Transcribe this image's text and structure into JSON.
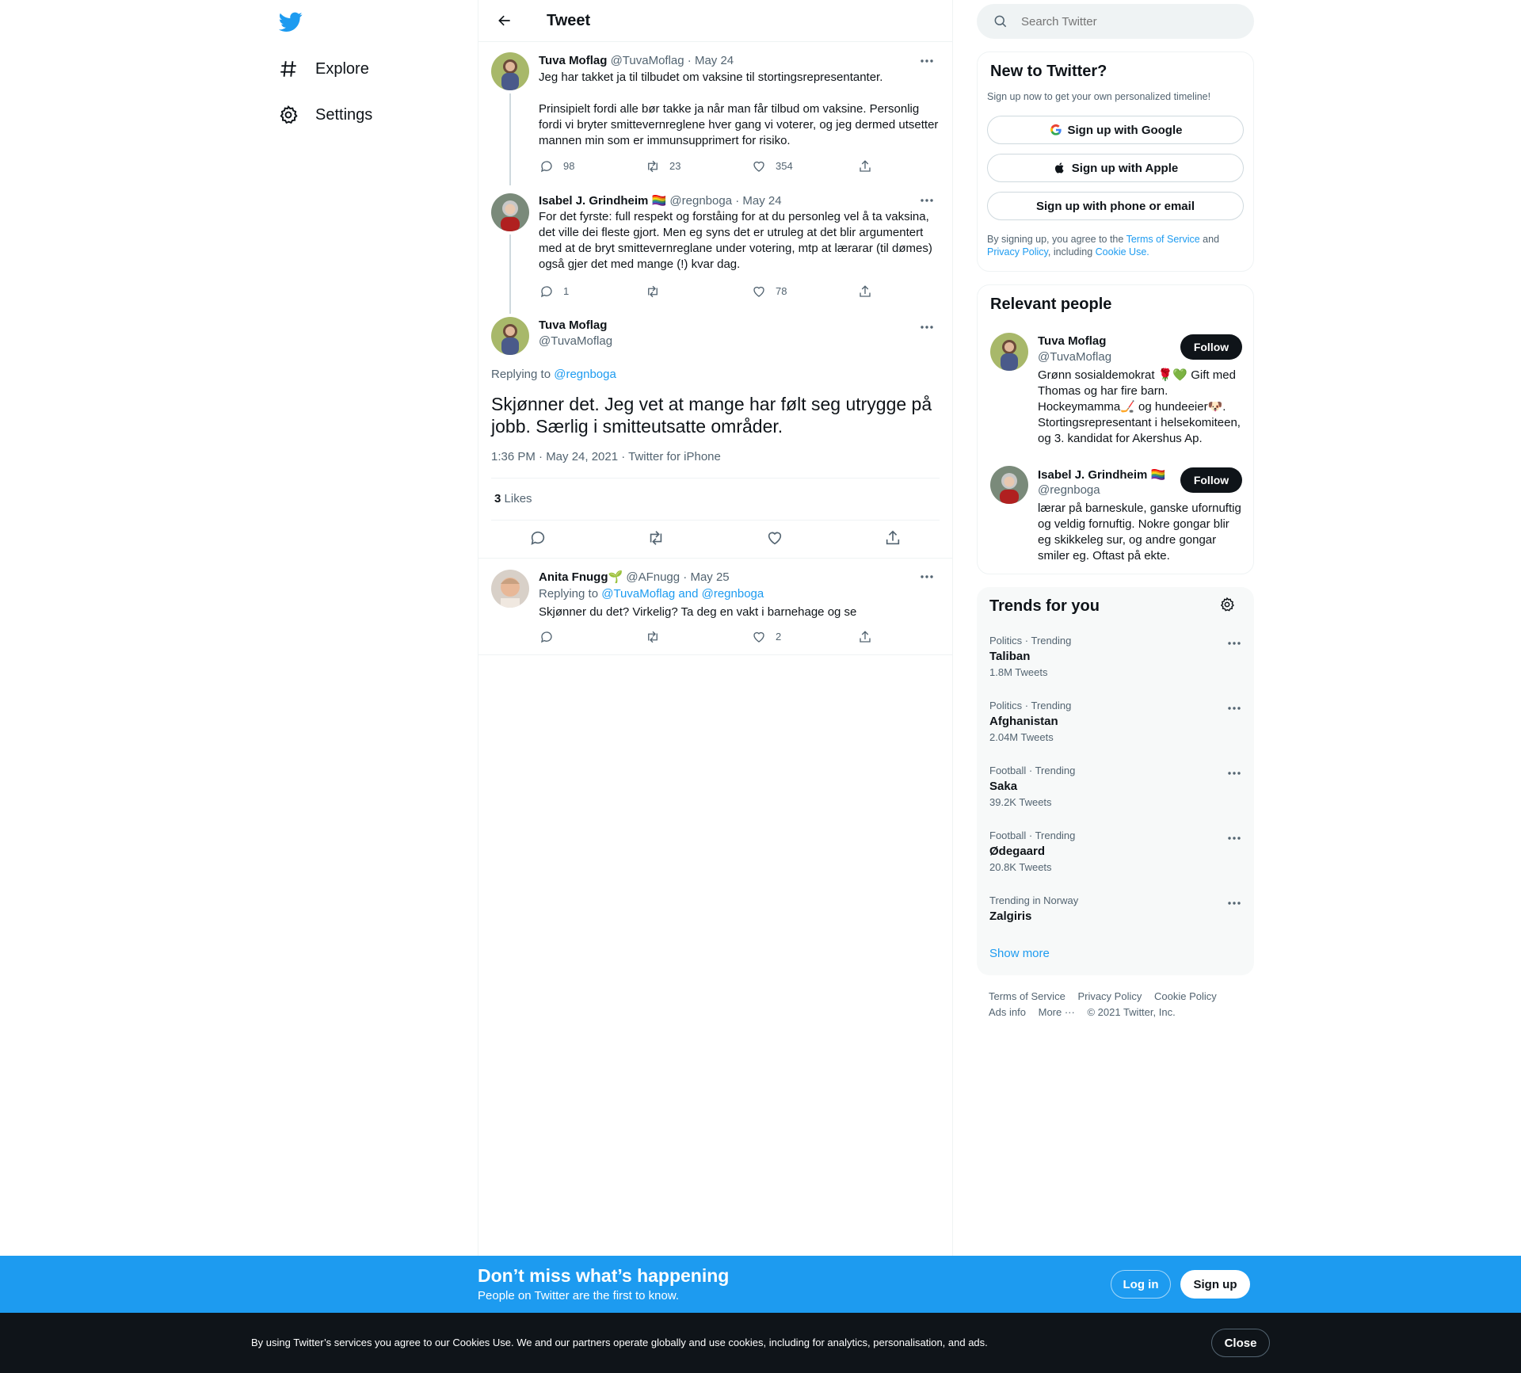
{
  "nav": {
    "explore_label": "Explore",
    "settings_label": "Settings"
  },
  "header": {
    "title": "Tweet"
  },
  "thread": [
    {
      "name": "Tuva Moflag",
      "handle": "@TuvaMoflag",
      "date": "· May 24",
      "lines": [
        "Jeg har takket ja til tilbudet om vaksine til stortingsrepresentanter.",
        "",
        "Prinsipielt fordi alle bør takke ja når man får tilbud om vaksine. Personlig",
        "fordi vi bryter smittevernreglene hver gang vi voterer, og jeg dermed utsetter",
        "mannen min som er immunsupprimert for risiko."
      ],
      "replies": "98",
      "retweets": "23",
      "likes": "354"
    },
    {
      "name": "Isabel J. Grindheim",
      "flag": "🏳️‍🌈",
      "handle": "@regnboga",
      "date": "· May 24",
      "lines": [
        "For det fyrste: full respekt og forståing for at du personleg vel å ta vaksina,",
        "det ville dei fleste gjort. Men eg syns det er utruleg at det blir argumentert",
        "med at de bryt smittevernreglane under votering, mtp at lærarar (til dømes)",
        "også gjer det med mange (!) kvar dag."
      ],
      "replies": "1",
      "retweets": "",
      "likes": "78"
    }
  ],
  "main_tweet": {
    "name": "Tuva Moflag",
    "handle": "@TuvaMoflag",
    "replying_prefix": "Replying to",
    "replying_to": "@regnboga",
    "text_line1": "Skjønner det. Jeg vet at mange har følt seg utrygge på",
    "text_line2": "jobb. Særlig i smitteutsatte områder.",
    "timestamp": "1:36 PM · May 24, 2021 · Twitter for iPhone",
    "likes_count": "3",
    "likes_label": "Likes"
  },
  "reply": {
    "name": "Anita Fnugg",
    "emoji": "🌱",
    "handle": "@AFnugg",
    "date": "· May 25",
    "replying_prefix": "Replying to",
    "replying_to": "@TuvaMoflag and @regnboga",
    "text": "Skjønner du det? Virkelig? Ta deg en vakt i barnehage og se",
    "replies": "",
    "retweets": "",
    "likes": "2"
  },
  "search": {
    "placeholder": "Search Twitter"
  },
  "new_to_twitter": {
    "title": "New to Twitter?",
    "subtitle": "Sign up now to get your own personalized timeline!",
    "google": "Sign up with Google",
    "apple": "Sign up with Apple",
    "phone": "Sign up with phone or email",
    "legal_1": "By signing up, you agree to the",
    "tos": "Terms of Service",
    "legal_and": "and",
    "privacy": "Privacy Policy",
    "legal_including": ", including",
    "cookie": "Cookie Use."
  },
  "relevant_people": {
    "title": "Relevant people",
    "people": [
      {
        "name": "Tuva Moflag",
        "handle": "@TuvaMoflag",
        "follow": "Follow",
        "bio": [
          "Grønn sosialdemokrat 🌹💚 Gift med",
          "Thomas og har fire barn.",
          "Hockeymamma🏒 og hundeeier🐶.",
          "Stortingsrepresentant i helsekomiteen,",
          "og 3. kandidat for Akershus Ap."
        ]
      },
      {
        "name": "Isabel J. Grindheim 🏳️‍🌈",
        "handle": "@regnboga",
        "follow": "Follow",
        "bio": [
          "lærar på barneskule, ganske ufornuftig",
          "og veldig fornuftig. Nokre gongar blir",
          "eg skikkeleg sur, og andre gongar",
          "smiler eg. Oftast på ekte."
        ]
      }
    ]
  },
  "trends": {
    "title": "Trends for you",
    "items": [
      {
        "category": "Politics · Trending",
        "name": "Taliban",
        "count": "1.8M Tweets"
      },
      {
        "category": "Politics · Trending",
        "name": "Afghanistan",
        "count": "2.04M Tweets"
      },
      {
        "category": "Football · Trending",
        "name": "Saka",
        "count": "39.2K Tweets"
      },
      {
        "category": "Football · Trending",
        "name": "Ødegaard",
        "count": "20.8K Tweets"
      },
      {
        "category": "Trending in Norway",
        "name": "Zalgiris",
        "count": ""
      }
    ],
    "show_more": "Show more"
  },
  "footer": {
    "tos": "Terms of Service",
    "privacy": "Privacy Policy",
    "cookie": "Cookie Policy",
    "ads": "Ads info",
    "more": "More ···",
    "copyright": "© 2021 Twitter, Inc."
  },
  "banner": {
    "title": "Don’t miss what’s happening",
    "subtitle": "People on Twitter are the first to know.",
    "login": "Log in",
    "signup": "Sign up"
  },
  "cookie_bar": {
    "text": "By using Twitter’s services you agree to our Cookies Use. We and our partners operate globally and use cookies, including for analytics, personalisation, and ads.",
    "close": "Close"
  },
  "colors": {
    "brand": "#1d9bf0",
    "text": "#0f1419",
    "secondary": "#536471",
    "border": "#eff3f4"
  }
}
